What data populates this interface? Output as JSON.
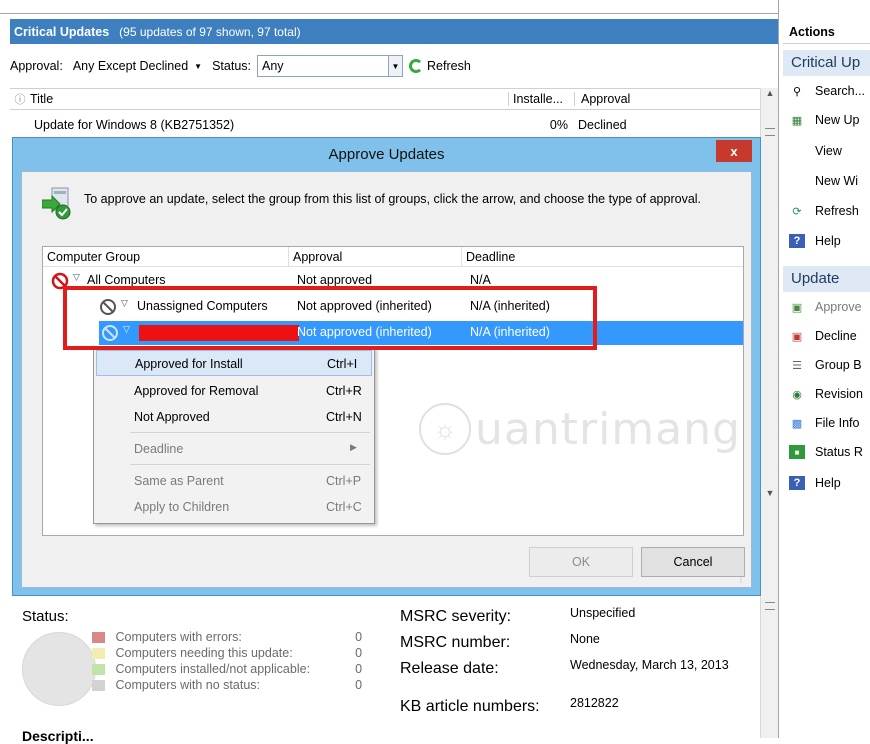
{
  "updates_view": {
    "title": "Critical Updates",
    "count_text": "(95 updates of 97 shown, 97 total)",
    "filter": {
      "approval_label": "Approval:",
      "approval_value": "Any Except Declined",
      "status_label": "Status:",
      "status_value": "Any",
      "refresh_label": "Refresh"
    },
    "columns": {
      "title": "Title",
      "installed": "Installe...",
      "approval": "Approval"
    },
    "rows": [
      {
        "title": "Update for Windows 8 (KB2751352)",
        "installed": "0%",
        "approval": "Declined"
      }
    ]
  },
  "details": {
    "status_label": "Status:",
    "legend": [
      {
        "label": "Computers with errors:",
        "count": "0",
        "color": "#d9888a"
      },
      {
        "label": "Computers needing this update:",
        "count": "0",
        "color": "#f2eeb0"
      },
      {
        "label": "Computers installed/not applicable:",
        "count": "0",
        "color": "#bfe3a8"
      },
      {
        "label": "Computers with no status:",
        "count": "0",
        "color": "#d2d2d2"
      }
    ],
    "msrc_severity_label": "MSRC severity:",
    "msrc_severity": "Unspecified",
    "msrc_number_label": "MSRC number:",
    "msrc_number": "None",
    "release_date_label": "Release date:",
    "release_date": "Wednesday, March 13, 2013",
    "kb_label": "KB article numbers:",
    "kb_value": "2812822",
    "description_label": "Descripti..."
  },
  "actions": {
    "header": "Actions",
    "section1": "Critical Up",
    "items1": [
      {
        "label": "Search...",
        "icon": "search-icon"
      },
      {
        "label": "New Up",
        "icon": "new-update-view-icon"
      },
      {
        "label": "View",
        "icon": ""
      },
      {
        "label": "New Wi",
        "icon": ""
      },
      {
        "label": "Refresh",
        "icon": "refresh-icon"
      },
      {
        "label": "Help",
        "icon": "help-icon"
      }
    ],
    "section2": "Update",
    "items2": [
      {
        "label": "Approve",
        "icon": "approve-icon"
      },
      {
        "label": "Decline",
        "icon": "decline-icon"
      },
      {
        "label": "Group B",
        "icon": "group-icon"
      },
      {
        "label": "Revision",
        "icon": "revision-icon"
      },
      {
        "label": "File Info",
        "icon": "file-info-icon"
      },
      {
        "label": "Status R",
        "icon": "status-report-icon"
      },
      {
        "label": "Help",
        "icon": "help-icon"
      }
    ]
  },
  "dialog": {
    "title": "Approve Updates",
    "close_label": "x",
    "instructions": "To approve an update, select the group from this list of groups, click the arrow, and choose the type of approval.",
    "columns": {
      "group": "Computer Group",
      "approval": "Approval",
      "deadline": "Deadline"
    },
    "groups": [
      {
        "name": "All Computers",
        "approval": "Not approved",
        "deadline": "N/A"
      },
      {
        "name": "Unassigned Computers",
        "approval": "Not approved (inherited)",
        "deadline": "N/A (inherited)"
      },
      {
        "name": "",
        "approval": "Not approved (inherited)",
        "deadline": "N/A (inherited)"
      }
    ],
    "menu": [
      {
        "label": "Approved for Install",
        "shortcut": "Ctrl+I"
      },
      {
        "label": "Approved for Removal",
        "shortcut": "Ctrl+R"
      },
      {
        "label": "Not Approved",
        "shortcut": "Ctrl+N"
      },
      {
        "label": "Deadline",
        "shortcut": ""
      },
      {
        "label": "Same as Parent",
        "shortcut": "Ctrl+P"
      },
      {
        "label": "Apply to Children",
        "shortcut": "Ctrl+C"
      }
    ],
    "ok_label": "OK",
    "cancel_label": "Cancel"
  },
  "watermark_text": "uantrimang",
  "colors": {
    "header_blue": "#3d7fbf",
    "dialog_frame": "#7fc1ea",
    "selection": "#3399ff",
    "highlight_red": "#e31b1b"
  }
}
